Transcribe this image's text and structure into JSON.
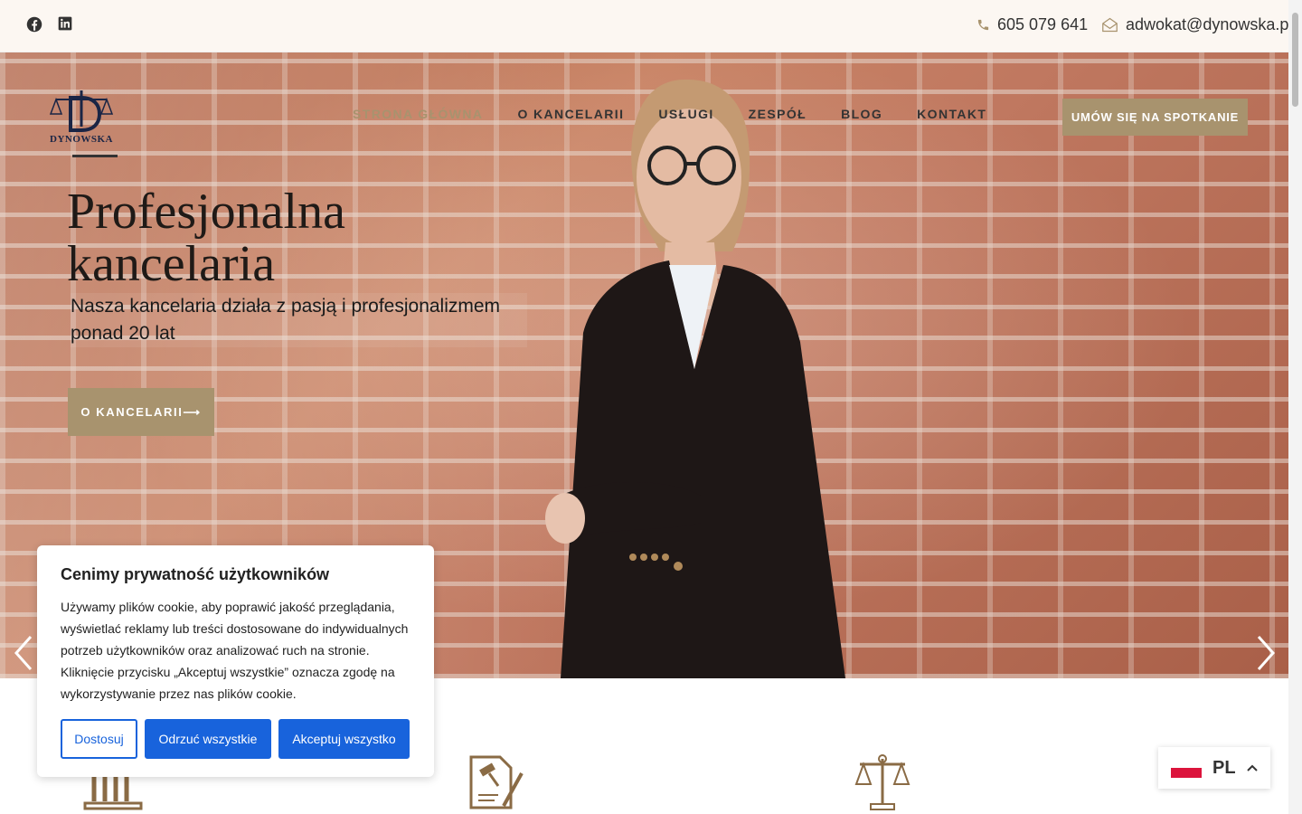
{
  "topbar": {
    "phone": "605 079 641",
    "email": "adwokat@dynowska.pl",
    "socials": [
      "facebook-icon",
      "linkedin-icon"
    ]
  },
  "logo": {
    "text": "DYNOWSKA"
  },
  "nav": {
    "items": [
      "STRONA GŁÓWNA",
      "O KANCELARII",
      "USŁUGI",
      "ZESPÓŁ",
      "BLOG",
      "KONTAKT"
    ],
    "active": "STRONA GŁÓWNA",
    "cta": "UMÓW SIĘ NA SPOTKANIE"
  },
  "hero": {
    "title_line1": "Profesjonalna",
    "title_line2": "kancelaria",
    "subtitle": "Nasza kancelaria działa z pasją i profesjonalizmem ponad 20 lat",
    "button": "O KANCELARII⟶"
  },
  "cookie": {
    "title": "Cenimy prywatność użytkowników",
    "text": "Używamy plików cookie, aby poprawić jakość przeglądania, wyświetlać reklamy lub treści dostosowane do indywidualnych potrzeb użytkowników oraz analizować ruch na stronie. Kliknięcie przycisku „Akceptuj wszystkie” oznacza zgodę na wykorzystywanie przez nas plików cookie.",
    "customize": "Dostosuj",
    "reject": "Odrzuć wszystkie",
    "accept": "Akceptuj wszystko"
  },
  "language": {
    "code": "PL"
  },
  "colors": {
    "accent": "#a8936e",
    "primary": "#1863dc",
    "dark": "#1a2545"
  }
}
